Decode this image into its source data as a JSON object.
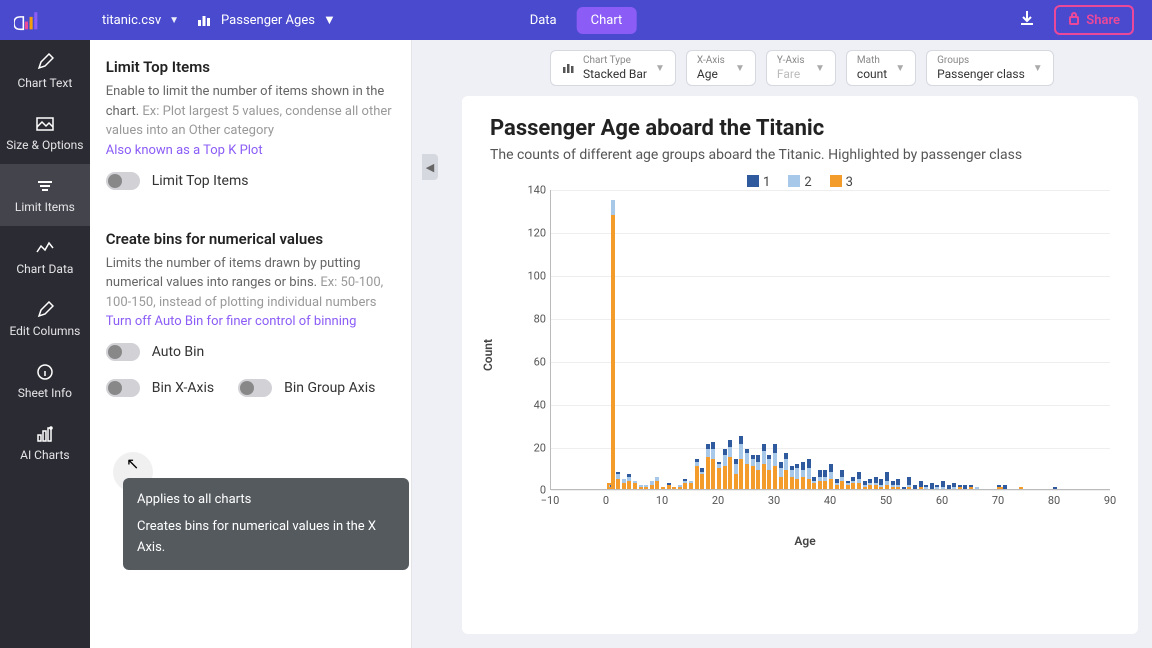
{
  "topbar": {
    "filename": "titanic.csv",
    "chartname": "Passenger Ages",
    "tabs": {
      "data": "Data",
      "chart": "Chart"
    },
    "share": "Share"
  },
  "sidebar": {
    "items": [
      {
        "label": "Chart Text"
      },
      {
        "label": "Size & Options"
      },
      {
        "label": "Limit Items"
      },
      {
        "label": "Chart Data"
      },
      {
        "label": "Edit Columns"
      },
      {
        "label": "Sheet Info"
      },
      {
        "label": "AI Charts"
      }
    ]
  },
  "panel": {
    "limit": {
      "title": "Limit Top Items",
      "desc": "Enable to limit the number of items shown in the chart. ",
      "ex": "Ex: Plot largest 5 values, condense all other values into an Other category",
      "link": "Also known as a Top K Plot",
      "toggle_label": "Limit Top Items"
    },
    "bins": {
      "title": "Create bins for numerical values",
      "desc": "Limits the number of items drawn by putting numerical values into ranges or bins. ",
      "ex": "Ex: 50-100, 100-150, instead of plotting individual numbers",
      "link": "Turn off Auto Bin for finer control of binning",
      "auto_label": "Auto Bin",
      "binx_label": "Bin X-Axis",
      "bingroup_label": "Bin Group Axis"
    }
  },
  "tooltip": {
    "line1": "Applies to all charts",
    "line2": "Creates bins for numerical values in the X Axis."
  },
  "config": {
    "chart_type": {
      "label": "Chart Type",
      "value": "Stacked Bar"
    },
    "xaxis": {
      "label": "X-Axis",
      "value": "Age"
    },
    "yaxis": {
      "label": "Y-Axis",
      "value": "Fare",
      "placeholder": true
    },
    "math": {
      "label": "Math",
      "value": "count"
    },
    "groups": {
      "label": "Groups",
      "value": "Passenger class"
    }
  },
  "chart": {
    "title": "Passenger Age aboard the Titanic",
    "subtitle": "The counts of different age groups aboard the Titanic. Highlighted by passenger class",
    "legend": [
      "1",
      "2",
      "3"
    ],
    "xlabel": "Age",
    "ylabel": "Count"
  },
  "chart_data": {
    "type": "bar",
    "stacked": true,
    "title": "Passenger Age aboard the Titanic",
    "subtitle": "The counts of different age groups aboard the Titanic. Highlighted by passenger class",
    "xlabel": "Age",
    "ylabel": "Count",
    "ylim": [
      0,
      140
    ],
    "xlim": [
      -10,
      90
    ],
    "yticks": [
      0,
      20,
      40,
      60,
      80,
      100,
      120,
      140
    ],
    "xticks": [
      -10,
      0,
      10,
      20,
      30,
      40,
      50,
      60,
      70,
      80,
      90
    ],
    "series_names": [
      "1",
      "2",
      "3"
    ],
    "series_colors": [
      "#2f5a9e",
      "#a8c8ea",
      "#f39c2b"
    ],
    "bars": [
      {
        "x": 0.42,
        "s": [
          0,
          0,
          3
        ]
      },
      {
        "x": 0.67,
        "s": [
          1,
          0,
          1
        ]
      },
      {
        "x": 0.75,
        "s": [
          0,
          1,
          1
        ]
      },
      {
        "x": 0.83,
        "s": [
          1,
          0,
          1
        ]
      },
      {
        "x": 0.92,
        "s": [
          0,
          0,
          1
        ]
      },
      {
        "x": 1,
        "s": [
          0,
          7,
          128
        ]
      },
      {
        "x": 2,
        "s": [
          1,
          2,
          5
        ]
      },
      {
        "x": 3,
        "s": [
          0,
          2,
          3
        ]
      },
      {
        "x": 4,
        "s": [
          1,
          2,
          4
        ]
      },
      {
        "x": 5,
        "s": [
          0,
          1,
          3
        ]
      },
      {
        "x": 6,
        "s": [
          0,
          1,
          1
        ]
      },
      {
        "x": 7,
        "s": [
          0,
          1,
          1
        ]
      },
      {
        "x": 8,
        "s": [
          0,
          2,
          2
        ]
      },
      {
        "x": 9,
        "s": [
          0,
          2,
          4
        ]
      },
      {
        "x": 10,
        "s": [
          0,
          0,
          1
        ]
      },
      {
        "x": 11,
        "s": [
          1,
          0,
          2
        ]
      },
      {
        "x": 12,
        "s": [
          0,
          0,
          1
        ]
      },
      {
        "x": 13,
        "s": [
          0,
          1,
          1
        ]
      },
      {
        "x": 14,
        "s": [
          1,
          1,
          3
        ]
      },
      {
        "x": 15,
        "s": [
          0,
          1,
          3
        ]
      },
      {
        "x": 16,
        "s": [
          1,
          2,
          11
        ]
      },
      {
        "x": 17,
        "s": [
          2,
          1,
          7
        ]
      },
      {
        "x": 18,
        "s": [
          2,
          4,
          15
        ]
      },
      {
        "x": 19,
        "s": [
          3,
          5,
          14
        ]
      },
      {
        "x": 20,
        "s": [
          1,
          2,
          10
        ]
      },
      {
        "x": 21,
        "s": [
          3,
          5,
          11
        ]
      },
      {
        "x": 22,
        "s": [
          3,
          5,
          15
        ]
      },
      {
        "x": 23,
        "s": [
          2,
          5,
          7
        ]
      },
      {
        "x": 24,
        "s": [
          4,
          7,
          14
        ]
      },
      {
        "x": 25,
        "s": [
          2,
          5,
          12
        ]
      },
      {
        "x": 26,
        "s": [
          2,
          3,
          11
        ]
      },
      {
        "x": 27,
        "s": [
          3,
          4,
          9
        ]
      },
      {
        "x": 28,
        "s": [
          3,
          6,
          12
        ]
      },
      {
        "x": 29,
        "s": [
          2,
          5,
          9
        ]
      },
      {
        "x": 30,
        "s": [
          4,
          6,
          11
        ]
      },
      {
        "x": 31,
        "s": [
          3,
          4,
          6
        ]
      },
      {
        "x": 32,
        "s": [
          3,
          5,
          9
        ]
      },
      {
        "x": 33,
        "s": [
          2,
          3,
          6
        ]
      },
      {
        "x": 34,
        "s": [
          2,
          5,
          5
        ]
      },
      {
        "x": 35,
        "s": [
          4,
          3,
          6
        ]
      },
      {
        "x": 36,
        "s": [
          4,
          5,
          5
        ]
      },
      {
        "x": 37,
        "s": [
          2,
          1,
          3
        ]
      },
      {
        "x": 38,
        "s": [
          3,
          2,
          4
        ]
      },
      {
        "x": 39,
        "s": [
          3,
          2,
          4
        ]
      },
      {
        "x": 40,
        "s": [
          4,
          3,
          5
        ]
      },
      {
        "x": 41,
        "s": [
          2,
          1,
          2
        ]
      },
      {
        "x": 42,
        "s": [
          3,
          2,
          4
        ]
      },
      {
        "x": 43,
        "s": [
          1,
          1,
          2
        ]
      },
      {
        "x": 44,
        "s": [
          2,
          1,
          3
        ]
      },
      {
        "x": 45,
        "s": [
          3,
          2,
          3
        ]
      },
      {
        "x": 46,
        "s": [
          2,
          1,
          1
        ]
      },
      {
        "x": 47,
        "s": [
          2,
          1,
          2
        ]
      },
      {
        "x": 48,
        "s": [
          3,
          1,
          2
        ]
      },
      {
        "x": 49,
        "s": [
          3,
          1,
          1
        ]
      },
      {
        "x": 50,
        "s": [
          4,
          2,
          2
        ]
      },
      {
        "x": 51,
        "s": [
          2,
          1,
          1
        ]
      },
      {
        "x": 52,
        "s": [
          3,
          1,
          1
        ]
      },
      {
        "x": 53,
        "s": [
          1,
          0,
          0
        ]
      },
      {
        "x": 54,
        "s": [
          4,
          1,
          1
        ]
      },
      {
        "x": 55,
        "s": [
          2,
          0,
          0
        ]
      },
      {
        "x": 56,
        "s": [
          3,
          0,
          1
        ]
      },
      {
        "x": 57,
        "s": [
          1,
          1,
          0
        ]
      },
      {
        "x": 58,
        "s": [
          3,
          0,
          0
        ]
      },
      {
        "x": 59,
        "s": [
          1,
          1,
          0
        ]
      },
      {
        "x": 60,
        "s": [
          3,
          1,
          0
        ]
      },
      {
        "x": 61,
        "s": [
          2,
          0,
          0
        ]
      },
      {
        "x": 62,
        "s": [
          2,
          1,
          0
        ]
      },
      {
        "x": 63,
        "s": [
          1,
          0,
          1
        ]
      },
      {
        "x": 64,
        "s": [
          2,
          0,
          0
        ]
      },
      {
        "x": 65,
        "s": [
          1,
          0,
          1
        ]
      },
      {
        "x": 66,
        "s": [
          0,
          1,
          0
        ]
      },
      {
        "x": 70,
        "s": [
          1,
          0,
          1
        ]
      },
      {
        "x": 70.5,
        "s": [
          0,
          0,
          1
        ]
      },
      {
        "x": 71,
        "s": [
          2,
          0,
          0
        ]
      },
      {
        "x": 74,
        "s": [
          0,
          0,
          1
        ]
      },
      {
        "x": 80,
        "s": [
          1,
          0,
          0
        ]
      }
    ]
  }
}
